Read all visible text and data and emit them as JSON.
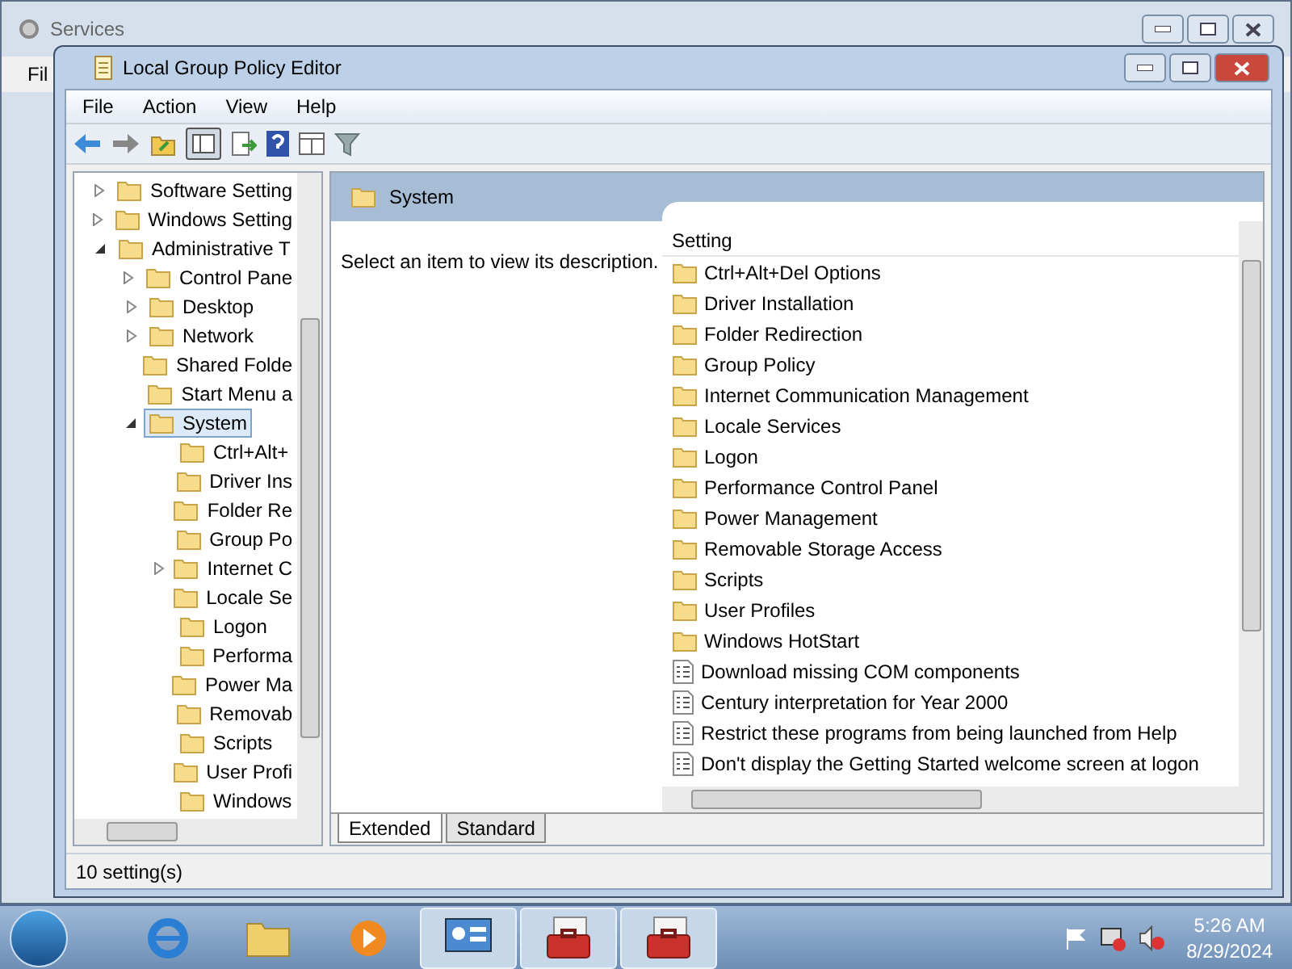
{
  "background_window": {
    "title": "Services",
    "menu": [
      "Fil"
    ]
  },
  "window": {
    "title": "Local Group Policy Editor"
  },
  "menu": [
    "File",
    "Action",
    "View",
    "Help"
  ],
  "tree": [
    {
      "label": "Software Setting",
      "expanded": false,
      "selected": false
    },
    {
      "label": "Windows Setting",
      "expanded": false,
      "selected": false
    },
    {
      "label": "Administrative T",
      "expanded": true,
      "selected": false,
      "children": [
        {
          "label": "Control Pane",
          "expanded": false,
          "selected": false
        },
        {
          "label": "Desktop",
          "expanded": false,
          "selected": false
        },
        {
          "label": "Network",
          "expanded": false,
          "selected": false
        },
        {
          "label": "Shared Folde",
          "selected": false
        },
        {
          "label": "Start Menu a",
          "selected": false
        },
        {
          "label": "System",
          "expanded": true,
          "selected": true,
          "children": [
            {
              "label": "Ctrl+Alt+",
              "selected": false
            },
            {
              "label": "Driver Ins",
              "selected": false
            },
            {
              "label": "Folder Re",
              "selected": false
            },
            {
              "label": "Group Po",
              "selected": false
            },
            {
              "label": "Internet C",
              "expanded": false,
              "selected": false
            },
            {
              "label": "Locale Se",
              "selected": false
            },
            {
              "label": "Logon",
              "selected": false
            },
            {
              "label": "Performa",
              "selected": false
            },
            {
              "label": "Power Ma",
              "selected": false
            },
            {
              "label": "Removab",
              "selected": false
            },
            {
              "label": "Scripts",
              "selected": false
            },
            {
              "label": "User Profi",
              "selected": false
            },
            {
              "label": "Windows",
              "selected": false
            }
          ]
        }
      ]
    }
  ],
  "details": {
    "title": "System",
    "description": "Select an item to view its description.",
    "column": "Setting",
    "rows": [
      {
        "kind": "folder",
        "name": "Ctrl+Alt+Del Options"
      },
      {
        "kind": "folder",
        "name": "Driver Installation"
      },
      {
        "kind": "folder",
        "name": "Folder Redirection"
      },
      {
        "kind": "folder",
        "name": "Group Policy"
      },
      {
        "kind": "folder",
        "name": "Internet Communication Management"
      },
      {
        "kind": "folder",
        "name": "Locale Services"
      },
      {
        "kind": "folder",
        "name": "Logon"
      },
      {
        "kind": "folder",
        "name": "Performance Control Panel"
      },
      {
        "kind": "folder",
        "name": "Power Management"
      },
      {
        "kind": "folder",
        "name": "Removable Storage Access"
      },
      {
        "kind": "folder",
        "name": "Scripts"
      },
      {
        "kind": "folder",
        "name": "User Profiles"
      },
      {
        "kind": "folder",
        "name": "Windows HotStart"
      },
      {
        "kind": "setting",
        "name": "Download missing COM components"
      },
      {
        "kind": "setting",
        "name": "Century interpretation for Year 2000"
      },
      {
        "kind": "setting",
        "name": "Restrict these programs from being launched from Help"
      },
      {
        "kind": "setting",
        "name": "Don't display the Getting Started welcome screen at logon"
      }
    ],
    "tabs": [
      {
        "label": "Extended",
        "selected": true
      },
      {
        "label": "Standard",
        "selected": false
      }
    ]
  },
  "status_bar": "10 setting(s)",
  "clock": {
    "time": "5:26 AM",
    "date": "8/29/2024"
  }
}
